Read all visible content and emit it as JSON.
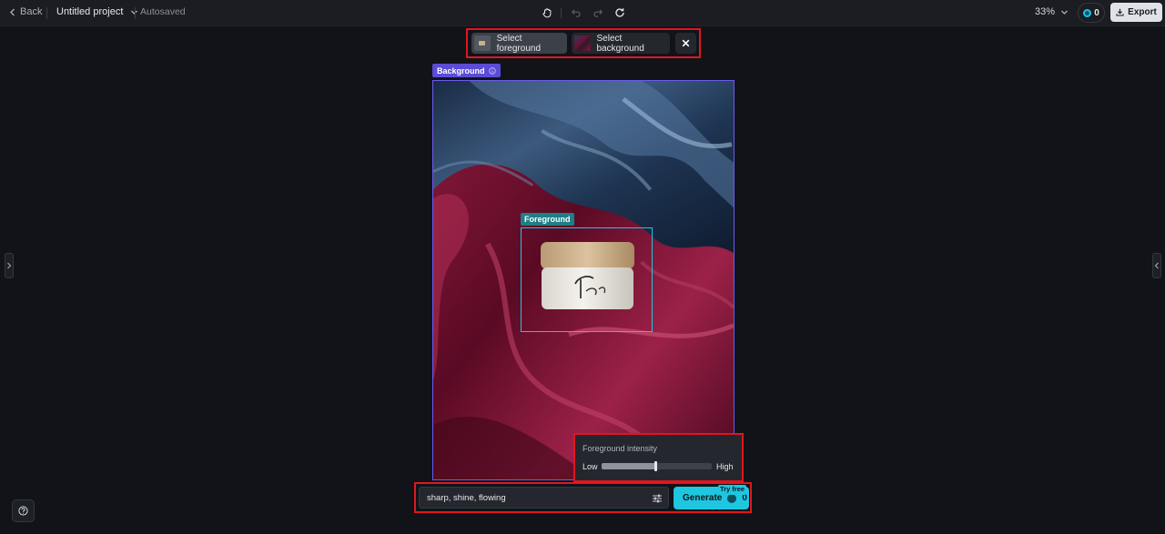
{
  "topbar": {
    "back_label": "Back",
    "project_title": "Untitled project",
    "save_status": "Autosaved",
    "zoom_level": "33%",
    "credits": "0",
    "export_label": "Export"
  },
  "selector": {
    "foreground_label": "Select foreground",
    "background_label": "Select background"
  },
  "canvas": {
    "background_tag": "Background",
    "foreground_tag": "Foreground"
  },
  "intensity": {
    "title": "Foreground intensity",
    "low_label": "Low",
    "high_label": "High",
    "value": 0.49
  },
  "prompt": {
    "value": "sharp, shine, flowing",
    "generate_label": "Generate",
    "generate_cost": "0",
    "try_free_badge": "Try free"
  },
  "colors": {
    "accent": "#1ec6e0",
    "highlight_border": "#e0161e",
    "background_frame": "#6b5cf0",
    "foreground_frame": "#22c5e0"
  },
  "icons": [
    "chevron-left-icon",
    "chevron-down-icon",
    "hand-icon",
    "undo-icon",
    "redo-icon",
    "refresh-icon",
    "download-icon",
    "close-icon",
    "info-icon",
    "sliders-icon",
    "help-icon",
    "panel-expand-left-icon",
    "panel-expand-right-icon"
  ]
}
